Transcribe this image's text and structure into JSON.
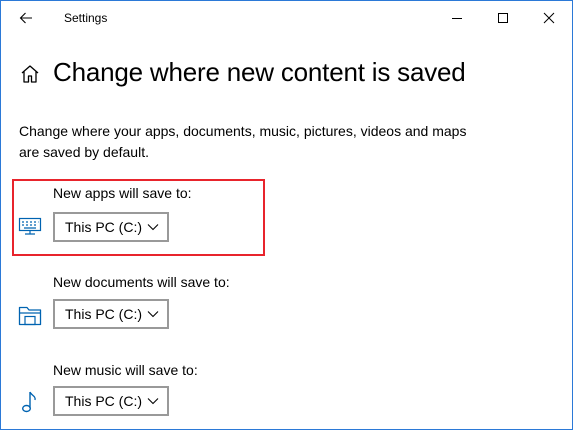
{
  "window": {
    "title": "Settings"
  },
  "header": {
    "title": "Change where new content is saved"
  },
  "description": "Change where your apps, documents, music, pictures, videos and maps are saved by default.",
  "sections": [
    {
      "label": "New apps will save to:",
      "value": "This PC (C:)",
      "icon": "monitor-keyboard-icon"
    },
    {
      "label": "New documents will save to:",
      "value": "This PC (C:)",
      "icon": "folder-icon"
    },
    {
      "label": "New music will save to:",
      "value": "This PC (C:)",
      "icon": "music-note-icon"
    }
  ],
  "colors": {
    "accent": "#0063b1",
    "highlight": "#e8242c",
    "window_border": "#2b79d7",
    "dropdown_border": "#999999"
  }
}
